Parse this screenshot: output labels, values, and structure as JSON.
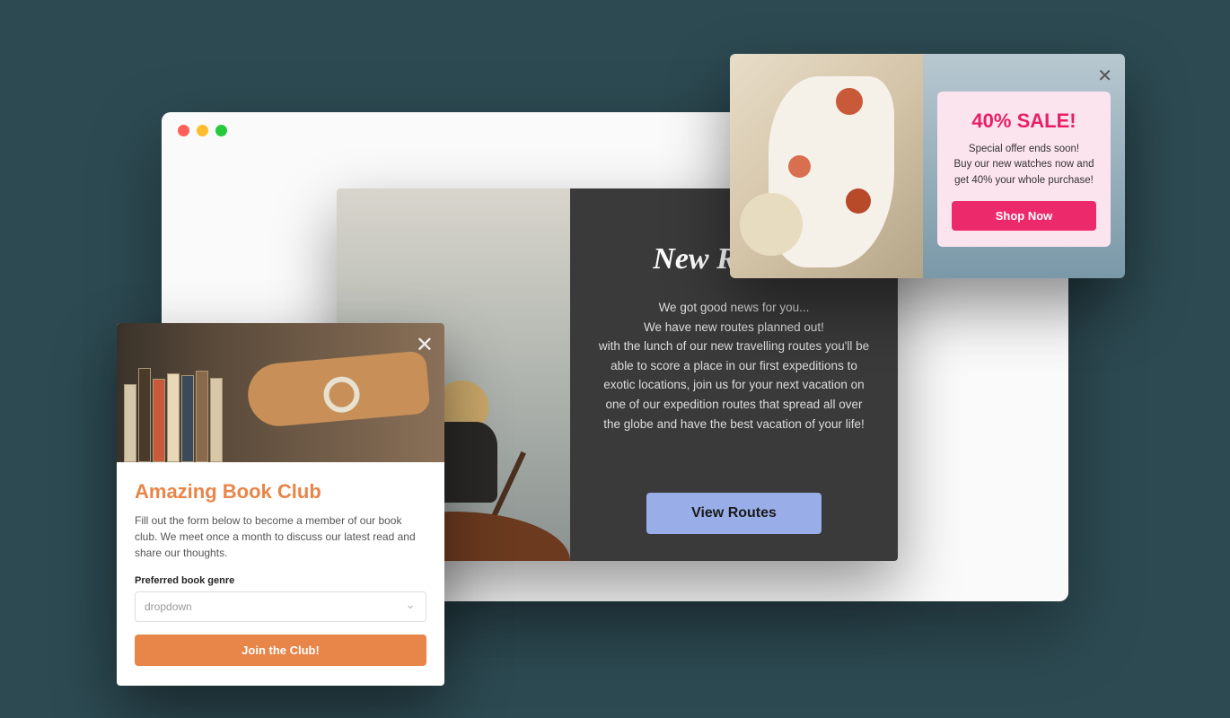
{
  "routes": {
    "title": "New Routes!",
    "body": "We got good news for you...\nWe have new routes planned out!\nwith the lunch of our new travelling routes you'll be able to score a place in our first expeditions to exotic locations, join us for your next vacation on one of our expedition routes that spread all over the globe and have the best vacation of your life!",
    "button": "View Routes"
  },
  "sale": {
    "title": "40% SALE!",
    "body": "Special offer ends soon!\nBuy our new watches now and get 40% your whole purchase!",
    "button": "Shop Now"
  },
  "book": {
    "title": "Amazing Book Club",
    "body": "Fill out the form below to become a member of our book club. We meet once a month to discuss our latest read and share our thoughts.",
    "field_label": "Preferred book genre",
    "placeholder": "dropdown",
    "button": "Join the Club!"
  }
}
